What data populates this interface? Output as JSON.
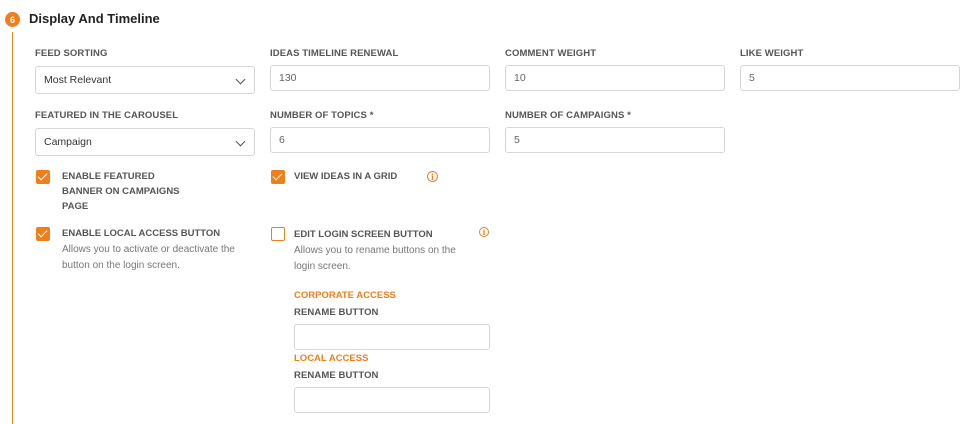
{
  "section": {
    "step_number": "6",
    "title": "Display And Timeline"
  },
  "fields": {
    "feed_sorting": {
      "label": "FEED SORTING",
      "value": "Most Relevant"
    },
    "ideas_timeline_renewal": {
      "label": "IDEAS TIMELINE RENEWAL",
      "value": "130"
    },
    "comment_weight": {
      "label": "COMMENT WEIGHT",
      "value": "10"
    },
    "like_weight": {
      "label": "LIKE WEIGHT",
      "value": "5"
    },
    "featured_in_carousel": {
      "label": "FEATURED IN THE CAROUSEL",
      "value": "Campaign"
    },
    "number_of_topics": {
      "label": "NUMBER OF TOPICS *",
      "value": "6"
    },
    "number_of_campaigns": {
      "label": "NUMBER OF CAMPAIGNS *",
      "value": "5"
    }
  },
  "checkboxes": {
    "enable_featured_banner": {
      "label_line1": "ENABLE FEATURED",
      "label_line2": "BANNER ON CAMPAIGNS",
      "label_line3": "PAGE",
      "checked": true
    },
    "view_ideas_grid": {
      "label": "VIEW IDEAS IN A GRID",
      "checked": true,
      "info_icon": "info-icon"
    },
    "enable_local_access": {
      "label": "ENABLE LOCAL ACCESS BUTTON",
      "desc_line1": "Allows you to activate or deactivate the",
      "desc_line2": "button on the login screen.",
      "checked": true
    },
    "edit_login_screen": {
      "label": "EDIT LOGIN SCREEN BUTTON",
      "desc_line1": "Allows you to rename buttons on the",
      "desc_line2": "login screen.",
      "checked": false,
      "info_icon": "info-icon"
    }
  },
  "login_buttons": {
    "corporate_access": {
      "heading": "CORPORATE ACCESS",
      "label": "RENAME BUTTON",
      "value": ""
    },
    "local_access": {
      "heading": "LOCAL ACCESS",
      "label": "RENAME BUTTON",
      "value": ""
    }
  },
  "colors": {
    "accent": "#ee7f1b",
    "border": "#d6d6d6",
    "text": "#555555"
  }
}
